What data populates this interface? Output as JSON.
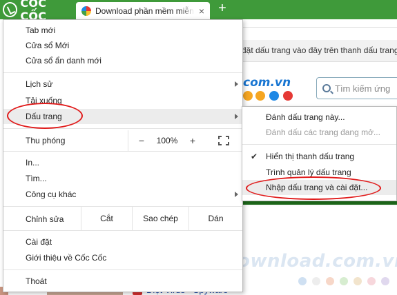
{
  "browser": {
    "brand": "CỐC CỐC",
    "tab_title": "Download phần mềm miễn phí",
    "tab_close": "×",
    "new_tab": "+"
  },
  "page": {
    "bookmark_hint": "đặt dấu trang vào đây trên thanh dấu trang",
    "site_logo": "com.vn",
    "search_placeholder": "Tìm kiếm ứng",
    "watermark": "Download.com.vn",
    "list_item": "Diệt Virus - Spyware",
    "logo_dot_colors": [
      "#f5a623",
      "#f5a623",
      "#1e88e5",
      "#e53935"
    ],
    "watermark_dot_colors": [
      "#cfe0f2",
      "#ededed",
      "#f7d7c8",
      "#d7edd0",
      "#f2e4cc",
      "#f7d7dc",
      "#e0d8ee"
    ]
  },
  "menu": {
    "new_tab": "Tab mới",
    "new_window": "Cửa sổ Mới",
    "incognito": "Cửa sổ ẩn danh mới",
    "history": "Lịch sử",
    "downloads": "Tải xuống",
    "bookmarks": "Dấu trang",
    "zoom": {
      "label": "Thu phóng",
      "minus": "−",
      "value": "100%",
      "plus": "+"
    },
    "print": "In...",
    "find": "Tìm...",
    "more_tools": "Công cụ khác",
    "edit": {
      "label": "Chỉnh sửa",
      "cut": "Cắt",
      "copy": "Sao chép",
      "paste": "Dán"
    },
    "settings": "Cài đặt",
    "about": "Giới thiệu về Cốc Cốc",
    "exit": "Thoát"
  },
  "submenu": {
    "bookmark_this": "Đánh dấu trang này...",
    "bookmark_open": "Đánh dấu các trang đang mở...",
    "show_bar": "Hiển thị thanh dấu trang",
    "check": "✔",
    "manager": "Trình quản lý dấu trang",
    "import": "Nhập dấu trang và cài đặt..."
  },
  "colors": {
    "tabbar": "#3f9a3a",
    "annotation": "#e01b1b"
  }
}
